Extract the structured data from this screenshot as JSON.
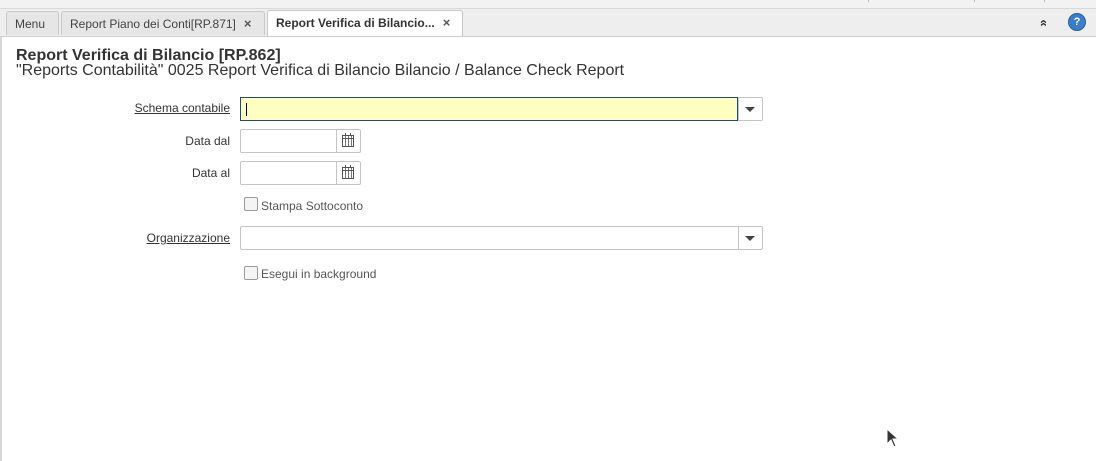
{
  "tabs": [
    {
      "label": "Menu",
      "active": false,
      "closable": false
    },
    {
      "label": "Report Piano dei Conti[RP.871]",
      "active": false,
      "closable": true
    },
    {
      "label": "Report Verifica di Bilancio...",
      "active": true,
      "closable": true
    }
  ],
  "header": {
    "title": "Report Verifica di Bilancio [RP.862]",
    "subtitle": "\"Reports Contabilità\" 0025 Report Verifica di Bilancio Bilancio / Balance Check Report"
  },
  "form": {
    "schema_label": "Schema contabile",
    "schema_value": "",
    "data_dal_label": "Data dal",
    "data_dal_value": "",
    "data_al_label": "Data al",
    "data_al_value": "",
    "stampa_label": "Stampa Sottoconto",
    "stampa_checked": false,
    "org_label": "Organizzazione",
    "org_value": "",
    "background_label": "Esegui in background",
    "background_checked": false
  },
  "icons": {
    "close": "×",
    "collapse": "»",
    "help": "?"
  },
  "colors": {
    "focus_field": "#ffffc0",
    "help_button": "#3a7dc9"
  }
}
